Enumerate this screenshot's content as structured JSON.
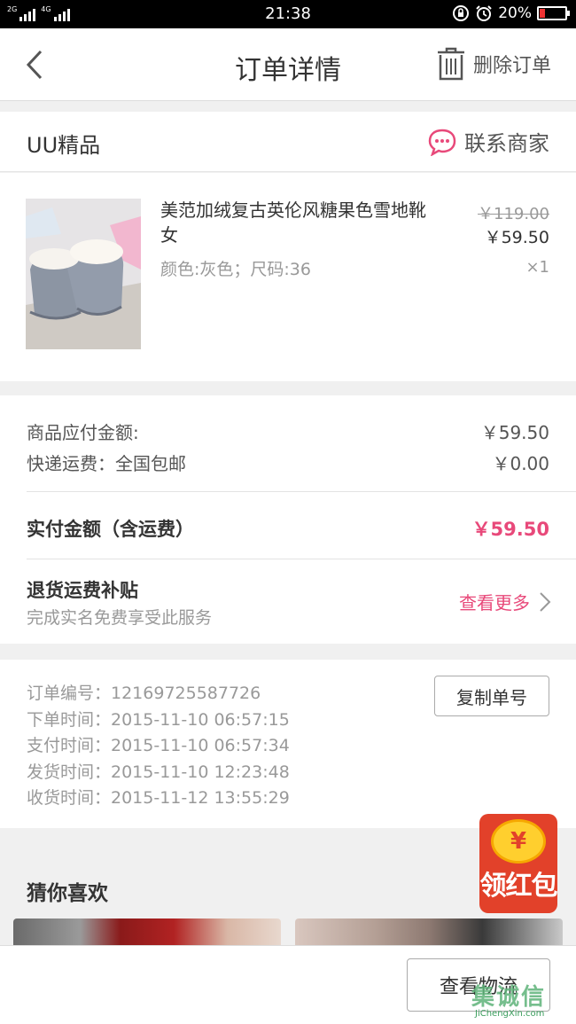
{
  "status_bar": {
    "net1": "2G",
    "net2": "4G",
    "time": "21:38",
    "battery": "20%"
  },
  "nav": {
    "title": "订单详情",
    "delete_label": "删除订单"
  },
  "shop": {
    "name": "UU精品",
    "contact_label": "联系商家"
  },
  "product": {
    "name": "美范加绒复古英伦风糖果色雪地靴女",
    "spec": "颜色:灰色；尺码:36",
    "original_price": "￥119.00",
    "price": "￥59.50",
    "quantity": "×1"
  },
  "amounts": {
    "goods_label": "商品应付金额:",
    "goods_value": "￥59.50",
    "shipping_label": "快递运费：全国包邮",
    "shipping_value": "￥0.00",
    "paid_label": "实付金额（含运费）",
    "paid_value": "￥59.50"
  },
  "refund": {
    "title": "退货运费补贴",
    "subtitle": "完成实名免费享受此服务",
    "more_label": "查看更多"
  },
  "order_info": {
    "number": "订单编号：12169725587726",
    "order_time": "下单时间：2015-11-10  06:57:15",
    "pay_time": "支付时间：2015-11-10  06:57:34",
    "ship_time": "发货时间：2015-11-10  12:23:48",
    "receive_time": "收货时间：2015-11-12  13:55:29",
    "copy_label": "复制单号"
  },
  "recommend": {
    "title": "猜你喜欢"
  },
  "red_packet": {
    "coin": "¥",
    "label": "领红包"
  },
  "bottom": {
    "logistics_label": "查看物流"
  },
  "watermark": {
    "logo": "集诚信",
    "url": "JiChengXin.com"
  },
  "colors": {
    "accent": "#e8497a",
    "red_packet": "#e2412a"
  }
}
